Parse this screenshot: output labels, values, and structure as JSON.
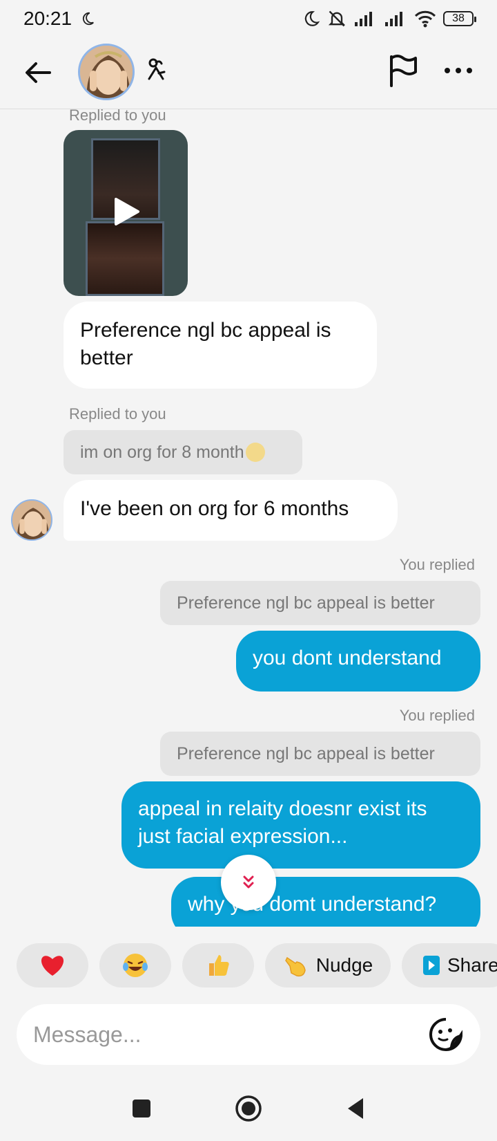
{
  "status_bar": {
    "time": "20:21",
    "battery": "38"
  },
  "header": {
    "contact_avatar": "contact-photo",
    "zodiac_icon": "zodiac-icon"
  },
  "messages": {
    "replied_label_1": "Replied to you",
    "message_1": "Preference ngl bc appeal is better",
    "replied_label_2": "Replied to you",
    "quote_2": "im on org for 8 month",
    "message_2": "I've been on org for 6 months",
    "you_replied_1": "You replied",
    "quote_3": "Preference ngl bc appeal is better",
    "message_3": "you dont understand",
    "you_replied_2": "You replied",
    "quote_4": "Preference ngl bc appeal is better",
    "message_4": "appeal in relaity doesnr exist its just facial expression...",
    "message_5": "why you domt understand?"
  },
  "reactions": {
    "nudge_label": "Nudge",
    "share_label": "Share"
  },
  "composer": {
    "placeholder": "Message..."
  },
  "colors": {
    "outgoing_bubble": "#0aa2d6",
    "incoming_bubble": "#ffffff",
    "quote_bubble": "#e4e4e4",
    "background": "#f4f4f4"
  }
}
